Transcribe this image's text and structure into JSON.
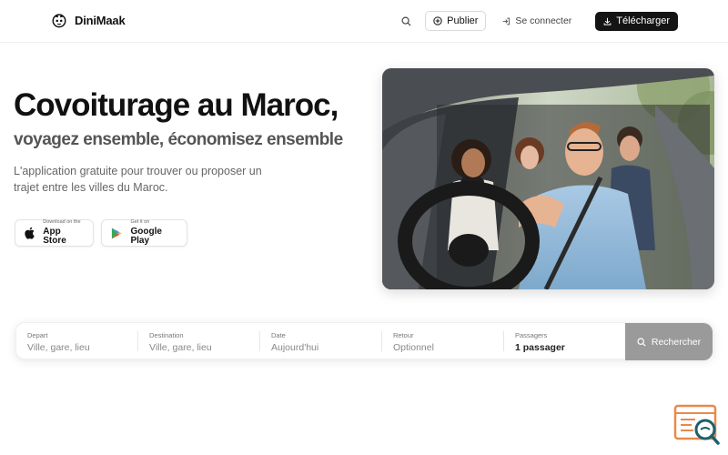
{
  "header": {
    "brand": "DiniMaak",
    "publish_label": "Publier",
    "login_label": "Se connecter",
    "download_label": "Télécharger"
  },
  "hero": {
    "title": "Covoiturage au Maroc,",
    "subtitle": "voyagez ensemble, économisez ensemble",
    "description": "L'application gratuite pour trouver ou proposer un trajet entre les villes du Maroc."
  },
  "stores": {
    "apple": {
      "small": "Download on the",
      "big": "App Store"
    },
    "google": {
      "small": "Get it on",
      "big": "Google Play"
    }
  },
  "search": {
    "depart": {
      "label": "Depart",
      "value": "Ville, gare, lieu"
    },
    "destination": {
      "label": "Destination",
      "value": "Ville, gare, lieu"
    },
    "date": {
      "label": "Date",
      "value": "Aujourd'hui"
    },
    "retour": {
      "label": "Retour",
      "value": "Optionnel"
    },
    "passagers": {
      "label": "Passagers",
      "value": "1 passager"
    },
    "submit_label": "Rechercher"
  },
  "colors": {
    "dark_button": "#141414",
    "search_button": "#9a9a9a",
    "widget_orange": "#e9894a",
    "widget_teal": "#1d5f6b"
  },
  "icons": [
    "mascot-logo-icon",
    "search-icon",
    "plus-circle-icon",
    "login-icon",
    "download-icon",
    "apple-icon",
    "google-play-icon",
    "chat-search-widget-icon"
  ]
}
